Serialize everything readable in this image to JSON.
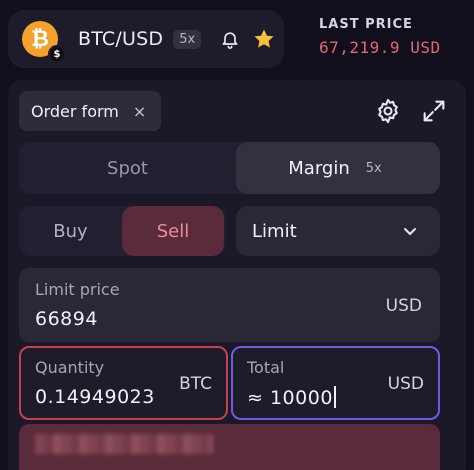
{
  "ticker": {
    "base": "BTC",
    "separator": "/",
    "quote": "USD",
    "leverage": "5x",
    "coin_symbol": "₿",
    "coin_sub_symbol": "$",
    "coin_color": "#f4a12b",
    "star_color": "#f5c03d",
    "icons": [
      "bitcoin-icon",
      "dollar-badge-icon",
      "bell-icon",
      "star-icon"
    ]
  },
  "last_price": {
    "label": "LAST PRICE",
    "value": "67,219.9 USD",
    "color": "#e06a72"
  },
  "order_form": {
    "tab_label": "Order form",
    "close_symbol": "×",
    "icons": [
      "gear-icon",
      "expand-icon"
    ]
  },
  "market_type": {
    "spot_label": "Spot",
    "margin_label": "Margin",
    "margin_leverage": "5x",
    "selected": "Margin"
  },
  "side": {
    "buy_label": "Buy",
    "sell_label": "Sell",
    "selected": "Sell",
    "sell_color": "#e8909a"
  },
  "order_type": {
    "selected": "Limit"
  },
  "limit_price": {
    "label": "Limit price",
    "value": "66894",
    "unit": "USD"
  },
  "quantity": {
    "label": "Quantity",
    "value": "0.14949023",
    "unit": "BTC",
    "border_color": "#c3424f"
  },
  "total": {
    "label": "Total",
    "value": "≈ 10000",
    "unit": "USD",
    "border_color": "#6f5ce6"
  }
}
